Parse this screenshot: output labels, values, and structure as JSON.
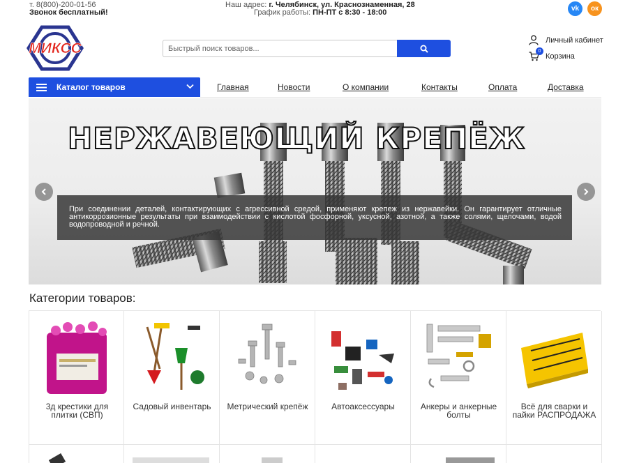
{
  "topbar": {
    "phone": "т. 8(800)-200-01-56",
    "freecall": "Звонок бесплатный!",
    "address_label": "Наш адрес: ",
    "address": "г. Челябинск, ул. Краснознаменная, 28",
    "hours_label": "График работы: ",
    "hours": "ПН-ПТ с 8:30 - 18:00",
    "social": [
      {
        "name": "vk",
        "glyph": "vk",
        "color": "#2787f5"
      },
      {
        "name": "ok",
        "glyph": "ок",
        "color": "#f7931e"
      }
    ]
  },
  "logo": {
    "text": "МИКСС",
    "color_red": "#e2231a",
    "color_blue": "#2a3590"
  },
  "search": {
    "placeholder": "Быстрый поиск товаров..."
  },
  "account": {
    "label": "Личный кабинет"
  },
  "cart": {
    "label": "Корзина",
    "count": "0"
  },
  "catalog": {
    "label": "Каталог товаров"
  },
  "nav": [
    {
      "label": "Главная"
    },
    {
      "label": "Новости"
    },
    {
      "label": "О компании"
    },
    {
      "label": "Контакты"
    },
    {
      "label": "Оплата"
    },
    {
      "label": "Доставка"
    }
  ],
  "banner": {
    "title": "НЕРЖАВЕЮЩИЙ КРЕПЁЖ",
    "text": "При соединении деталей, контактирующих с агрессивной средой, применяют крепеж из нержавейки. Он гарантирует отличные антикоррозионные результаты при взаимодействии с кислотой фосфорной, уксусной, азотной, а также солями, щелочами, водой водопроводной и речной."
  },
  "categories_heading": "Категории товаров:",
  "categories": [
    {
      "name": "3д крестики для плитки (СВП)",
      "icon": "tile-spacers"
    },
    {
      "name": "Садовый инвентарь",
      "icon": "garden-tools"
    },
    {
      "name": "Метрический крепёж",
      "icon": "bolts"
    },
    {
      "name": "Автоаксессуары",
      "icon": "car-accessories"
    },
    {
      "name": "Анкеры и анкерные болты",
      "icon": "anchors"
    },
    {
      "name": "Всё для сварки и пайки РАСПРОДАЖА",
      "icon": "welding-electrodes"
    }
  ],
  "colors": {
    "accent": "#1e4fe0"
  }
}
